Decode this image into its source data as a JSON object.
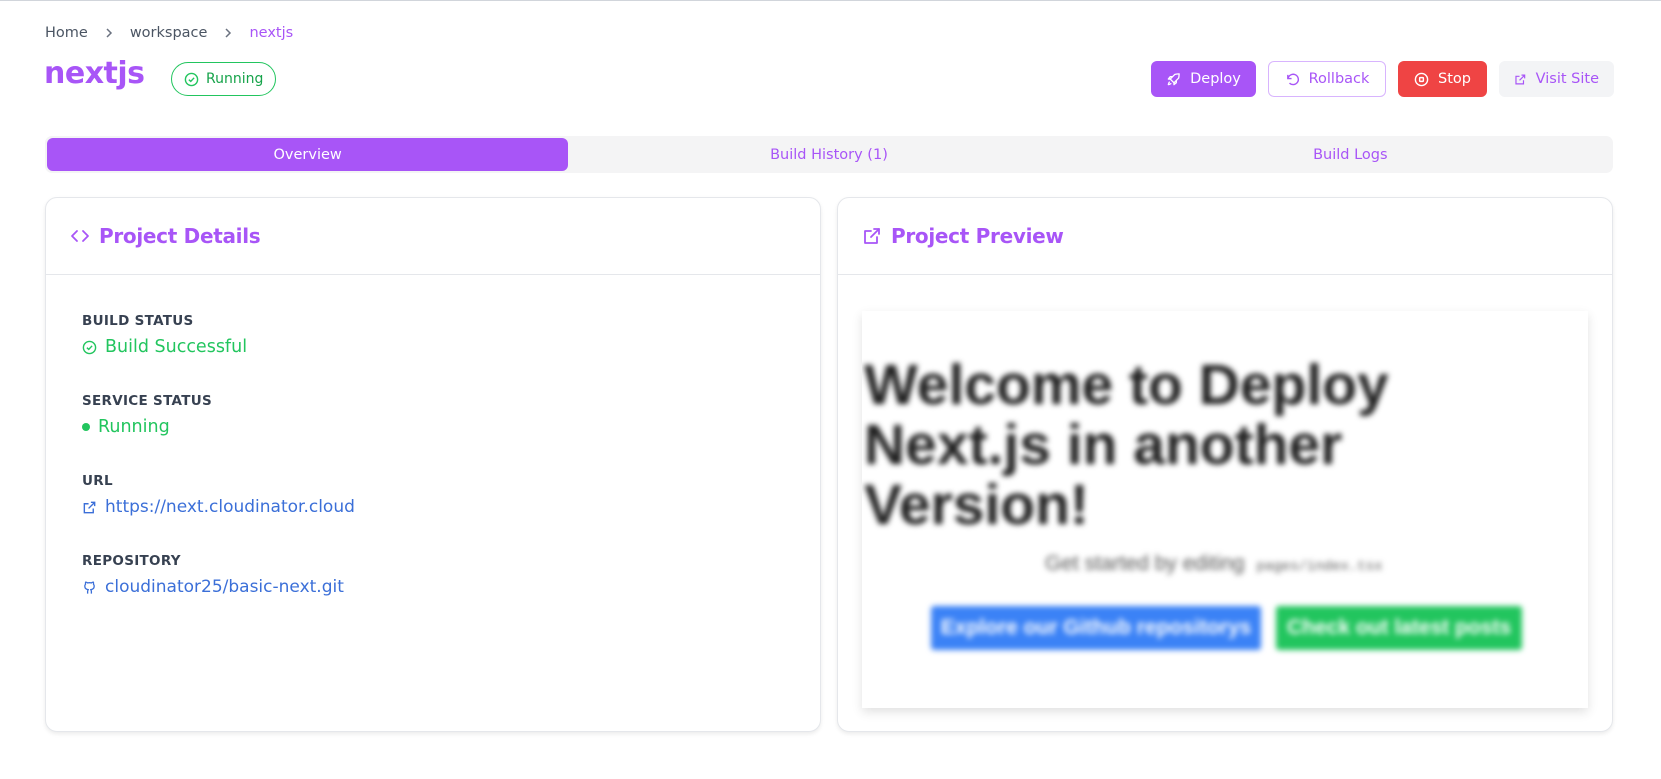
{
  "breadcrumb": {
    "items": [
      "Home",
      "workspace",
      "nextjs"
    ]
  },
  "header": {
    "title": "nextjs",
    "status": "Running"
  },
  "actions": {
    "deploy": "Deploy",
    "rollback": "Rollback",
    "stop": "Stop",
    "visit": "Visit Site"
  },
  "tabs": [
    {
      "label": "Overview",
      "active": true
    },
    {
      "label": "Build History (1)",
      "active": false
    },
    {
      "label": "Build Logs",
      "active": false
    }
  ],
  "details": {
    "title": "Project Details",
    "build_status_label": "BUILD STATUS",
    "build_status_value": "Build Successful",
    "service_status_label": "SERVICE STATUS",
    "service_status_value": "Running",
    "url_label": "URL",
    "url_value": "https://next.cloudinator.cloud",
    "repo_label": "REPOSITORY",
    "repo_value": "cloudinator25/basic-next.git"
  },
  "preview": {
    "title": "Project Preview",
    "heading": "Welcome to Deploy Next.js in another Version!",
    "subtitle": "Get started by editing",
    "subtitle_code": "pages/index.tsx",
    "button_primary": "Explore our Github repositorys",
    "button_secondary": "Check out latest posts"
  },
  "colors": {
    "accent": "#a855f7",
    "success": "#22c55e",
    "danger": "#ef4444",
    "link": "#3b6fd8"
  }
}
